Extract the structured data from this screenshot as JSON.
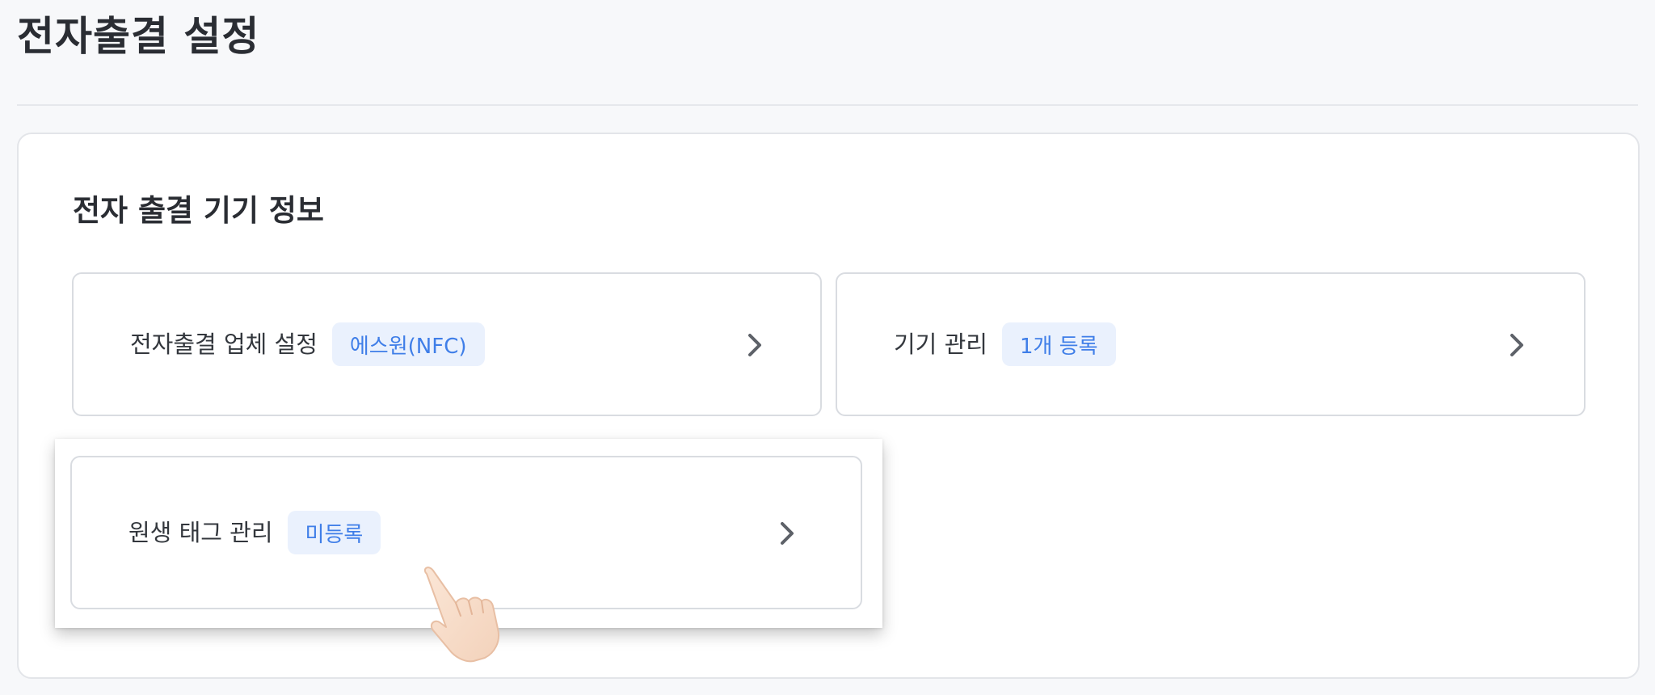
{
  "header": {
    "title": "전자출결 설정"
  },
  "section": {
    "title": "전자 출결 기기 정보"
  },
  "cards": [
    {
      "label": "전자출결 업체 설정",
      "badge": "에스원(NFC)"
    },
    {
      "label": "기기 관리",
      "badge": "1개 등록"
    },
    {
      "label": "원생 태그 관리",
      "badge": "미등록"
    }
  ],
  "colors": {
    "accent": "#3f7ee8",
    "badge_bg": "#eaf1fd"
  },
  "icons": {
    "card_arrow": "chevron-right-icon",
    "pointer": "pointing-hand-icon"
  }
}
